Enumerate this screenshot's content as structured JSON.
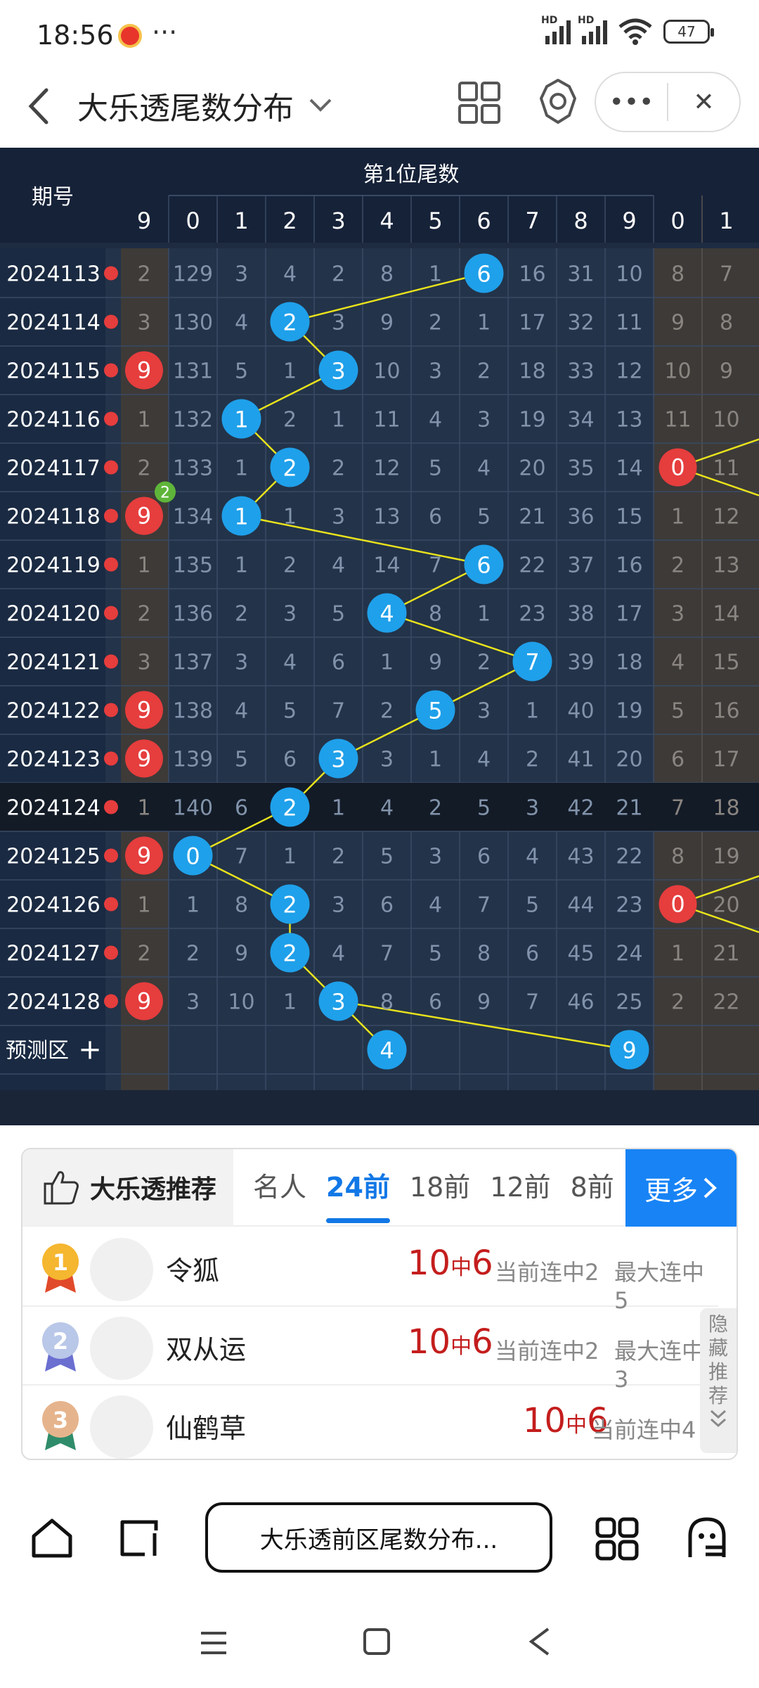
{
  "status_bar": {
    "time": "18:56",
    "more": "···",
    "signal1_label": "HD",
    "signal2_label": "HD",
    "battery": "47"
  },
  "title_bar": {
    "title": "大乐透尾数分布",
    "more_label": "•••",
    "close_label": "✕"
  },
  "chart": {
    "header_period": "期号",
    "header_group": "第1位尾数",
    "prev_col_header": "9",
    "digit_headers": [
      "0",
      "1",
      "2",
      "3",
      "4",
      "5",
      "6",
      "7",
      "8",
      "9"
    ],
    "next_col_headers": [
      "0",
      "1"
    ],
    "rows": [
      {
        "period": "2024113",
        "prev": "2",
        "cells": [
          "129",
          "3",
          "4",
          "2",
          "8",
          "1",
          "6",
          "16",
          "31",
          "10"
        ],
        "next": [
          "8",
          "7"
        ],
        "hit": 6,
        "prevHit": false,
        "nextHit": false
      },
      {
        "period": "2024114",
        "prev": "3",
        "cells": [
          "130",
          "4",
          "2",
          "3",
          "9",
          "2",
          "1",
          "17",
          "32",
          "11"
        ],
        "next": [
          "9",
          "8"
        ],
        "hit": 2,
        "prevHit": false,
        "nextHit": false
      },
      {
        "period": "2024115",
        "prev": "9",
        "cells": [
          "131",
          "5",
          "1",
          "3",
          "10",
          "3",
          "2",
          "18",
          "33",
          "12"
        ],
        "next": [
          "10",
          "9"
        ],
        "hit": 3,
        "prevHit": true,
        "nextHit": false
      },
      {
        "period": "2024116",
        "prev": "1",
        "cells": [
          "132",
          "1",
          "2",
          "1",
          "11",
          "4",
          "3",
          "19",
          "34",
          "13"
        ],
        "next": [
          "11",
          "10"
        ],
        "hit": 1,
        "prevHit": false,
        "nextHit": false
      },
      {
        "period": "2024117",
        "prev": "2",
        "cells": [
          "133",
          "1",
          "2",
          "2",
          "12",
          "5",
          "4",
          "20",
          "35",
          "14"
        ],
        "next": [
          "0",
          "11"
        ],
        "hit": 2,
        "prevHit": false,
        "nextHit": true
      },
      {
        "period": "2024118",
        "prev": "9",
        "cells": [
          "134",
          "1",
          "1",
          "3",
          "13",
          "6",
          "5",
          "21",
          "36",
          "15"
        ],
        "next": [
          "1",
          "12"
        ],
        "hit": 1,
        "prevHit": true,
        "nextHit": false,
        "badge": "2"
      },
      {
        "period": "2024119",
        "prev": "1",
        "cells": [
          "135",
          "1",
          "2",
          "4",
          "14",
          "7",
          "6",
          "22",
          "37",
          "16"
        ],
        "next": [
          "2",
          "13"
        ],
        "hit": 6,
        "prevHit": false,
        "nextHit": false
      },
      {
        "period": "2024120",
        "prev": "2",
        "cells": [
          "136",
          "2",
          "3",
          "5",
          "4",
          "8",
          "1",
          "23",
          "38",
          "17"
        ],
        "next": [
          "3",
          "14"
        ],
        "hit": 4,
        "prevHit": false,
        "nextHit": false
      },
      {
        "period": "2024121",
        "prev": "3",
        "cells": [
          "137",
          "3",
          "4",
          "6",
          "1",
          "9",
          "2",
          "7",
          "39",
          "18"
        ],
        "next": [
          "4",
          "15"
        ],
        "hit": 7,
        "prevHit": false,
        "nextHit": false
      },
      {
        "period": "2024122",
        "prev": "9",
        "cells": [
          "138",
          "4",
          "5",
          "7",
          "2",
          "5",
          "3",
          "1",
          "40",
          "19"
        ],
        "next": [
          "5",
          "16"
        ],
        "hit": 5,
        "prevHit": true,
        "nextHit": false
      },
      {
        "period": "2024123",
        "prev": "9",
        "cells": [
          "139",
          "5",
          "6",
          "3",
          "3",
          "1",
          "4",
          "2",
          "41",
          "20"
        ],
        "next": [
          "6",
          "17"
        ],
        "hit": 3,
        "prevHit": true,
        "nextHit": false
      },
      {
        "period": "2024124",
        "prev": "1",
        "cells": [
          "140",
          "6",
          "2",
          "1",
          "4",
          "2",
          "5",
          "3",
          "42",
          "21"
        ],
        "next": [
          "7",
          "18"
        ],
        "hit": 2,
        "prevHit": false,
        "nextHit": false,
        "highlight": true
      },
      {
        "period": "2024125",
        "prev": "9",
        "cells": [
          "0",
          "7",
          "1",
          "2",
          "5",
          "3",
          "6",
          "4",
          "43",
          "22"
        ],
        "next": [
          "8",
          "19"
        ],
        "hit": 0,
        "prevHit": true,
        "nextHit": false
      },
      {
        "period": "2024126",
        "prev": "1",
        "cells": [
          "1",
          "8",
          "2",
          "3",
          "6",
          "4",
          "7",
          "5",
          "44",
          "23"
        ],
        "next": [
          "0",
          "20"
        ],
        "hit": 2,
        "prevHit": false,
        "nextHit": true
      },
      {
        "period": "2024127",
        "prev": "2",
        "cells": [
          "2",
          "9",
          "2",
          "4",
          "7",
          "5",
          "8",
          "6",
          "45",
          "24"
        ],
        "next": [
          "1",
          "21"
        ],
        "hit": 2,
        "prevHit": false,
        "nextHit": false
      },
      {
        "period": "2024128",
        "prev": "9",
        "cells": [
          "3",
          "10",
          "1",
          "3",
          "8",
          "6",
          "9",
          "7",
          "46",
          "25"
        ],
        "next": [
          "2",
          "22"
        ],
        "hit": 3,
        "prevHit": true,
        "nextHit": false
      }
    ],
    "predict_label": "预测区",
    "predict_plus": "+",
    "predict_balls": [
      "4",
      "9"
    ],
    "predict_cols": [
      4,
      9
    ],
    "colors": {
      "blue": "#1fa0ea",
      "red": "#e63d3d",
      "line": "#e8e21c",
      "bg": "#233349",
      "brown": "#3d3a38"
    }
  },
  "recommend": {
    "title": "大乐透推荐",
    "tabs": [
      "名人",
      "24前",
      "18前",
      "12前",
      "8前"
    ],
    "active_tab": "24前",
    "more": "更多",
    "hide_tab": "隐藏推荐",
    "rows": [
      {
        "rank": "1",
        "name": "令狐",
        "score_a": "10",
        "score_mid": "中",
        "score_b": "6",
        "current": "当前连中2",
        "max": "最大连中5"
      },
      {
        "rank": "2",
        "name": "双从运",
        "score_a": "10",
        "score_mid": "中",
        "score_b": "6",
        "current": "当前连中2",
        "max": "最大连中3"
      },
      {
        "rank": "3",
        "name": "仙鹤草",
        "score_a": "10",
        "score_mid": "中",
        "score_b": "6",
        "current": "当前连中4",
        "max": ""
      }
    ]
  },
  "bottom_nav": {
    "url_text": "大乐透前区尾数分布..."
  }
}
